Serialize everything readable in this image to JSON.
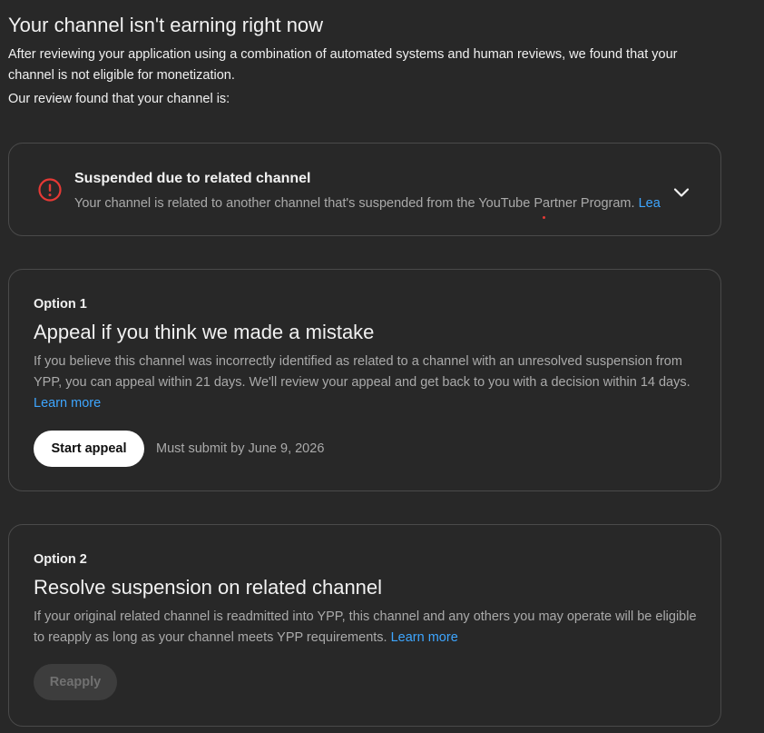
{
  "header": {
    "title": "Your channel isn't earning right now",
    "intro": "After reviewing your application using a combination of automated systems and human reviews, we found that your channel is not eligible for monetization.",
    "review_label": "Our review found that your channel is:"
  },
  "status": {
    "icon": "error-circle-icon",
    "icon_color": "#e53935",
    "title": "Suspended due to related channel",
    "description": "Your channel is related to another channel that's suspended from the YouTube Partner Program.",
    "link_text": "Lea",
    "expand_icon": "chevron-down-icon"
  },
  "option1": {
    "label": "Option 1",
    "title": "Appeal if you think we made a mistake",
    "description": "If you believe this channel was incorrectly identified as related to a channel with an unresolved suspension from YPP, you can appeal within 21 days. We'll review your appeal and get back to you with a decision within 14 days.",
    "link_text": "Learn more",
    "button_label": "Start appeal",
    "deadline": "Must submit by June 9, 2026"
  },
  "option2": {
    "label": "Option 2",
    "title": "Resolve suspension on related channel",
    "description": "If your original related channel is readmitted into YPP, this channel and any others you may operate will be eligible to reapply as long as your channel meets YPP requirements.",
    "link_text": "Learn more",
    "button_label": "Reapply"
  },
  "colors": {
    "background": "#282828",
    "link": "#3ea6ff",
    "error": "#e53935"
  }
}
